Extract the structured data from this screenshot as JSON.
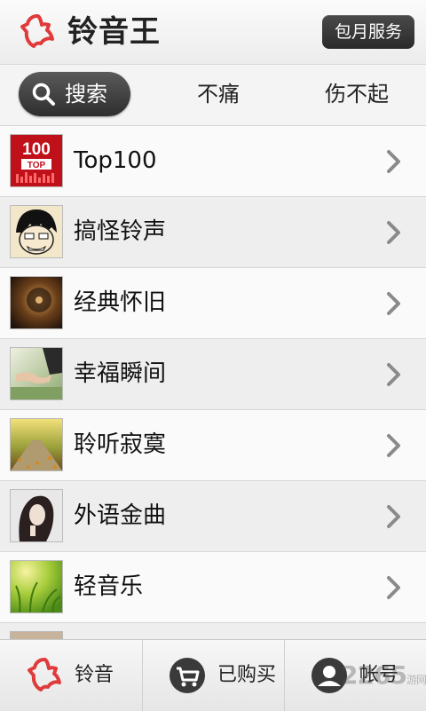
{
  "header": {
    "app_title": "铃音王",
    "monthly_service_label": "包月服务",
    "logo_icon": "bell-icon",
    "accent_color": "#e03030"
  },
  "search_row": {
    "search_label": "搜索",
    "keywords": [
      "不痛",
      "伤不起"
    ]
  },
  "list": {
    "items": [
      {
        "label": "Top100",
        "thumb": "top100-thumb"
      },
      {
        "label": "搞怪铃声",
        "thumb": "cartoon-face-thumb"
      },
      {
        "label": "经典怀旧",
        "thumb": "vinyl-record-thumb"
      },
      {
        "label": "幸福瞬间",
        "thumb": "holding-hands-thumb"
      },
      {
        "label": "聆听寂寞",
        "thumb": "autumn-road-thumb"
      },
      {
        "label": "外语金曲",
        "thumb": "singer-portrait-thumb"
      },
      {
        "label": "轻音乐",
        "thumb": "green-grass-thumb"
      }
    ]
  },
  "bottom_bar": {
    "tabs": [
      {
        "label": "铃音",
        "icon": "bell-icon"
      },
      {
        "label": "已购买",
        "icon": "cart-icon"
      },
      {
        "label": "帐号",
        "icon": "user-icon"
      }
    ]
  },
  "watermark": {
    "text": "2265",
    "suffix": "游网"
  }
}
